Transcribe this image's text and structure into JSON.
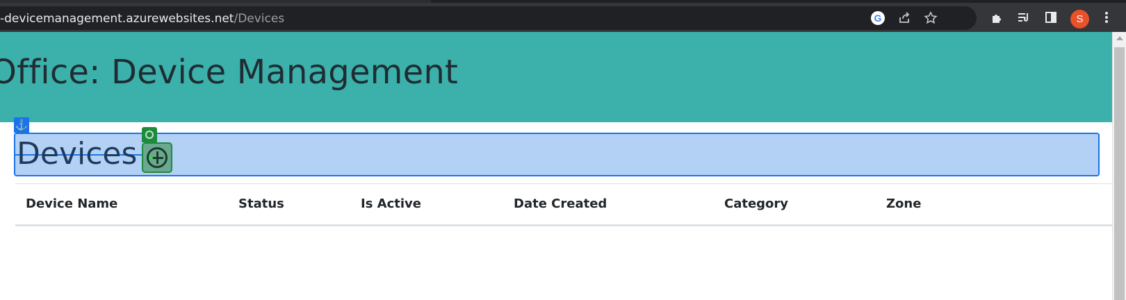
{
  "browser": {
    "url_host": "-devicemanagement.azurewebsites.net",
    "url_path": "/Devices",
    "avatar_initial": "S",
    "icons": [
      "google-icon",
      "share-icon",
      "star-icon",
      "extensions-icon",
      "media-control-icon",
      "side-panel-icon",
      "menu-icon"
    ]
  },
  "banner": {
    "title": "d Office: Device Management"
  },
  "section": {
    "title": "Devices"
  },
  "table": {
    "columns": [
      "Device Name",
      "Status",
      "Is Active",
      "Date Created",
      "Category",
      "Zone"
    ]
  },
  "colors": {
    "banner": "#3cb0aa",
    "selection_fill": "#b2d1f4",
    "selection_border": "#1a73e8",
    "add_accent": "#1e8a3e"
  }
}
